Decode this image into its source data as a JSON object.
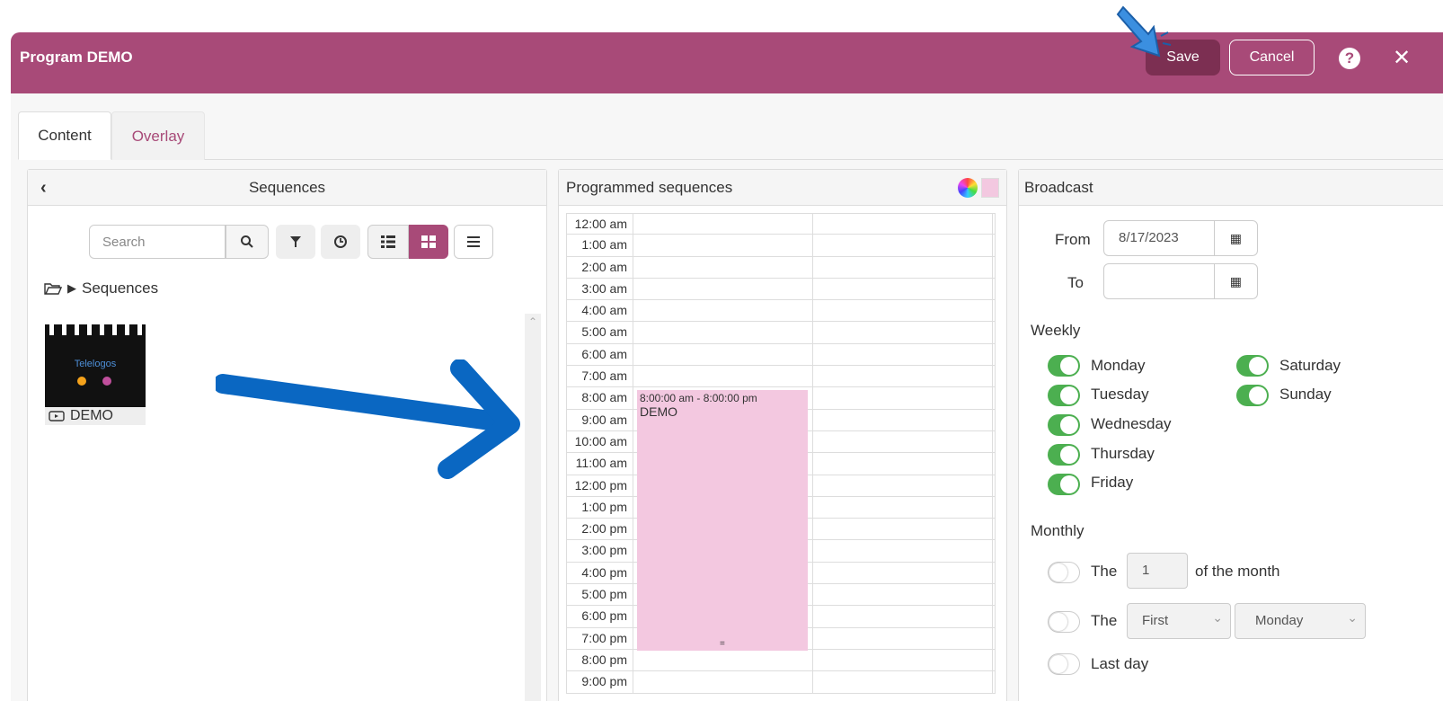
{
  "window": {
    "title": "Program DEMO",
    "save": "Save",
    "cancel": "Cancel",
    "help": "?",
    "close": "✕"
  },
  "tabs": [
    {
      "label": "Content"
    },
    {
      "label": "Overlay"
    }
  ],
  "sequences": {
    "back": "‹",
    "title": "Sequences",
    "search_placeholder": "Search",
    "folder": "Sequences",
    "item": {
      "logo": "Telelogos",
      "caption": "DEMO"
    }
  },
  "programmed": {
    "title": "Programmed sequences",
    "hours": [
      "12:00 am",
      "1:00 am",
      "2:00 am",
      "3:00 am",
      "4:00 am",
      "5:00 am",
      "6:00 am",
      "7:00 am",
      "8:00 am",
      "9:00 am",
      "10:00 am",
      "11:00 am",
      "12:00 pm",
      "1:00 pm",
      "2:00 pm",
      "3:00 pm",
      "4:00 pm",
      "5:00 pm",
      "6:00 pm",
      "7:00 pm",
      "8:00 pm",
      "9:00 pm"
    ],
    "event": {
      "time": "8:00:00 am - 8:00:00 pm",
      "name": "DEMO",
      "color": "#f3c8e0"
    }
  },
  "broadcast": {
    "title": "Broadcast",
    "from_label": "From",
    "from_value": "8/17/2023",
    "to_label": "To",
    "to_value": "",
    "weekly_label": "Weekly",
    "days": [
      "Monday",
      "Tuesday",
      "Wednesday",
      "Thursday",
      "Friday",
      "Saturday",
      "Sunday"
    ],
    "monthly_label": "Monthly",
    "the_label": "The",
    "day_value": "1",
    "of_month": "of the month",
    "ordinal": "First",
    "weekday": "Monday",
    "last_day": "Last day"
  },
  "colors": {
    "brand": "#a84a78",
    "toggle_on": "#4caf50",
    "arrow": "#0a67c2"
  }
}
